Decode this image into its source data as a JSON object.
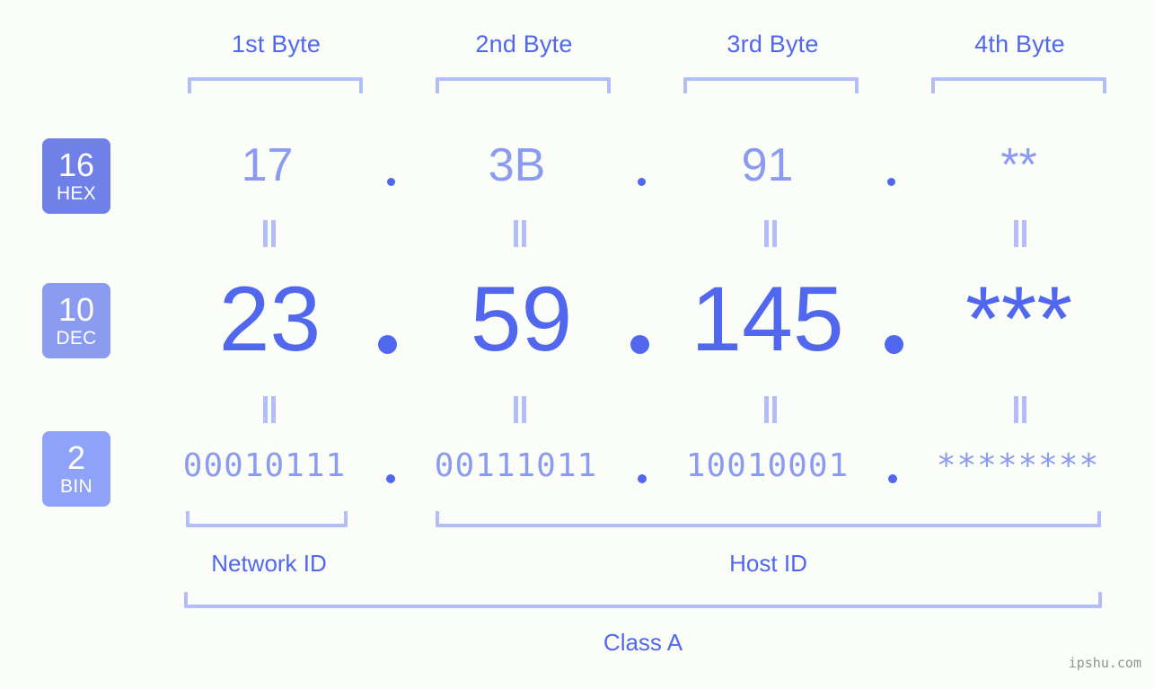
{
  "accent": {
    "text_blue": "#5067ee",
    "light_blue": "#8b9bef",
    "bracket": "#b3bdf8",
    "badge_hex": "#6f80e8",
    "badge_dec": "#8b9bf0",
    "badge_bin": "#8ea2f7",
    "background": "#fbfdf8",
    "watermark": "#8f9492"
  },
  "byte_headers": [
    {
      "label": "1st Byte"
    },
    {
      "label": "2nd Byte"
    },
    {
      "label": "3rd Byte"
    },
    {
      "label": "4th Byte"
    }
  ],
  "bases": [
    {
      "num": "16",
      "name": "HEX"
    },
    {
      "num": "10",
      "name": "DEC"
    },
    {
      "num": "2",
      "name": "BIN"
    }
  ],
  "rows": {
    "hex": {
      "base_num": "16",
      "base_name": "HEX",
      "values": [
        "17",
        "3B",
        "91",
        "**"
      ]
    },
    "dec": {
      "base_num": "10",
      "base_name": "DEC",
      "values": [
        "23",
        "59",
        "145",
        "***"
      ]
    },
    "bin": {
      "base_num": "2",
      "base_name": "BIN",
      "values": [
        "00010111",
        "00111011",
        "10010001",
        "********"
      ]
    }
  },
  "separators": {
    "dot": ".",
    "equals": "||"
  },
  "regions": [
    {
      "label": "Network ID"
    },
    {
      "label": "Host ID"
    }
  ],
  "class_label": "Class A",
  "watermark": "ipshu.com"
}
